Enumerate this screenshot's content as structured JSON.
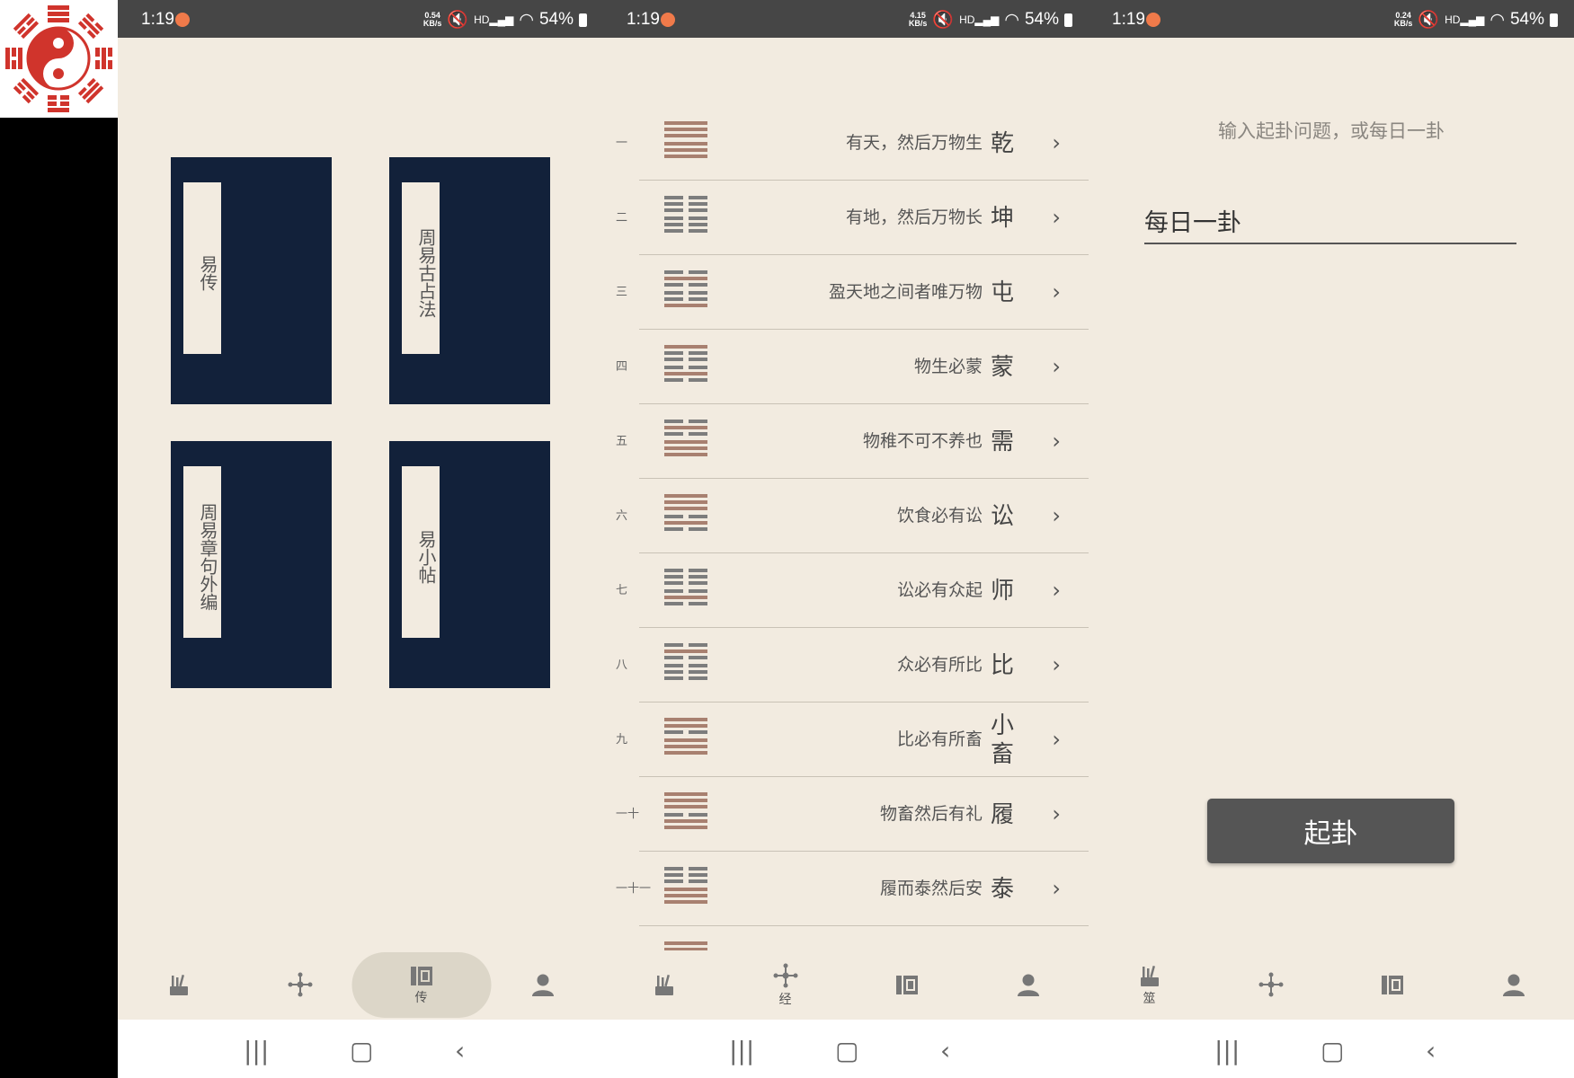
{
  "status": {
    "time": "1:19",
    "battery": "54%",
    "speeds": [
      "0.54",
      "4.15",
      "0.24"
    ],
    "speed_unit": "KB/s",
    "hd": "HD"
  },
  "books": [
    {
      "title": "易传"
    },
    {
      "title": "周易古占法"
    },
    {
      "title": "周易章句外编"
    },
    {
      "title": "易小帖"
    }
  ],
  "hexagrams": [
    {
      "num": "一",
      "desc": "有天，然后万物生",
      "name": "乾",
      "lines": [
        1,
        1,
        1,
        1,
        1,
        1
      ]
    },
    {
      "num": "二",
      "desc": "有地，然后万物长",
      "name": "坤",
      "lines": [
        0,
        0,
        0,
        0,
        0,
        0
      ]
    },
    {
      "num": "三",
      "desc": "盈天地之间者唯万物",
      "name": "屯",
      "lines": [
        0,
        1,
        0,
        0,
        0,
        1
      ]
    },
    {
      "num": "四",
      "desc": "物生必蒙",
      "name": "蒙",
      "lines": [
        1,
        0,
        0,
        0,
        1,
        0
      ]
    },
    {
      "num": "五",
      "desc": "物稚不可不养也",
      "name": "需",
      "lines": [
        0,
        1,
        0,
        1,
        1,
        1
      ]
    },
    {
      "num": "六",
      "desc": "饮食必有讼",
      "name": "讼",
      "lines": [
        1,
        1,
        1,
        0,
        1,
        0
      ]
    },
    {
      "num": "七",
      "desc": "讼必有众起",
      "name": "师",
      "lines": [
        0,
        0,
        0,
        0,
        1,
        0
      ]
    },
    {
      "num": "八",
      "desc": "众必有所比",
      "name": "比",
      "lines": [
        0,
        1,
        0,
        0,
        0,
        0
      ]
    },
    {
      "num": "九",
      "desc": "比必有所畜",
      "name": "小畜",
      "lines": [
        1,
        1,
        0,
        1,
        1,
        1
      ]
    },
    {
      "num": "一十",
      "desc": "物畜然后有礼",
      "name": "履",
      "lines": [
        1,
        1,
        1,
        0,
        1,
        1
      ]
    },
    {
      "num": "一十一",
      "desc": "履而泰然后安",
      "name": "泰",
      "lines": [
        0,
        0,
        0,
        1,
        1,
        1
      ]
    },
    {
      "num": "",
      "desc": "",
      "name": "",
      "lines": [
        1,
        1,
        1,
        1,
        1,
        1
      ]
    }
  ],
  "divine": {
    "question": "输入起卦问题，或每日一卦",
    "input_value": "每日一卦",
    "button": "起卦"
  },
  "nav": {
    "p1": [
      {
        "label": ""
      },
      {
        "label": ""
      },
      {
        "label": "传"
      },
      {
        "label": ""
      }
    ],
    "p2": [
      {
        "label": ""
      },
      {
        "label": "经"
      },
      {
        "label": ""
      },
      {
        "label": ""
      }
    ],
    "p3": [
      {
        "label": "筮"
      },
      {
        "label": ""
      },
      {
        "label": ""
      },
      {
        "label": ""
      }
    ]
  },
  "colors": {
    "yang": "#a88070",
    "yin": "#7d7d7d",
    "cover": "#12213a",
    "bg": "#f2ebe0"
  }
}
